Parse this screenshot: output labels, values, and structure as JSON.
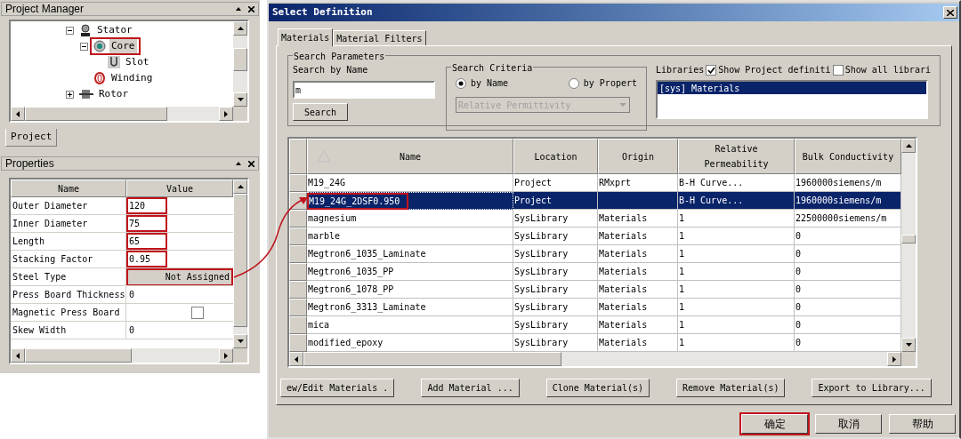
{
  "project_manager": {
    "title": "Project Manager",
    "tree": [
      {
        "label": "Stator",
        "kind": "stator",
        "expanded": true,
        "selected": false,
        "highlighted": false,
        "children": [
          {
            "label": "Core",
            "kind": "core",
            "expanded": true,
            "selected": true,
            "highlighted": true,
            "children": [
              {
                "label": "Slot",
                "kind": "slot",
                "selected": false,
                "highlighted": false
              }
            ]
          },
          {
            "label": "Winding",
            "kind": "winding",
            "selected": false,
            "highlighted": false
          }
        ]
      },
      {
        "label": "Rotor",
        "kind": "rotor",
        "expanded": false,
        "selected": false,
        "highlighted": false
      }
    ],
    "tab": "Project"
  },
  "properties": {
    "title": "Properties",
    "columns": [
      "Name",
      "Value"
    ],
    "rows": [
      {
        "name": "Outer Diameter",
        "value": "120",
        "kind": "text",
        "highlighted": true
      },
      {
        "name": "Inner Diameter",
        "value": "75",
        "kind": "text",
        "highlighted": true
      },
      {
        "name": "Length",
        "value": "65",
        "kind": "text",
        "highlighted": true
      },
      {
        "name": "Stacking Factor",
        "value": "0.95",
        "kind": "text",
        "highlighted": true
      },
      {
        "name": "Steel Type",
        "value": "Not Assigned",
        "kind": "button",
        "highlighted": true
      },
      {
        "name": "Press Board Thickness",
        "value": "0",
        "kind": "text",
        "highlighted": false
      },
      {
        "name": "Magnetic Press Board",
        "kind": "checkbox",
        "checked": false,
        "highlighted": false
      },
      {
        "name": "Skew Width",
        "value": "0",
        "kind": "text",
        "highlighted": false
      }
    ]
  },
  "dialog": {
    "title": "Select Definition",
    "tabs": [
      {
        "label": "Materials",
        "selected": true
      },
      {
        "label": "Material Filters",
        "selected": false
      }
    ],
    "search": {
      "group_title": "Search Parameters",
      "label": "Search by Name",
      "value": "m",
      "button": "Search"
    },
    "criteria": {
      "title": "Search Criteria",
      "options": [
        {
          "label": "by Name",
          "selected": true
        },
        {
          "label": "by Propert",
          "selected": false
        }
      ],
      "dropdown": {
        "value": "Relative Permittivity",
        "disabled": true
      }
    },
    "libraries": {
      "label": "Libraries",
      "checkboxes": [
        {
          "label": "Show Project definiti",
          "checked": true
        },
        {
          "label": "Show all librari",
          "checked": false
        }
      ],
      "items": [
        {
          "label": "[sys] Materials",
          "selected": true
        }
      ]
    },
    "table": {
      "columns": [
        "Name",
        "Location",
        "Origin",
        "Relative Permeability",
        "Bulk Conductivity"
      ],
      "rows": [
        {
          "cells": [
            "M19_24G",
            "Project",
            "RMxprt",
            "B-H Curve...",
            "1960000siemens/m"
          ],
          "selected": false,
          "highlighted": false
        },
        {
          "cells": [
            "M19_24G_2DSF0.950",
            "Project",
            "",
            "B-H Curve...",
            "1960000siemens/m"
          ],
          "selected": true,
          "highlighted": true
        },
        {
          "cells": [
            "magnesium",
            "SysLibrary",
            "Materials",
            "1",
            "22500000siemens/m"
          ],
          "selected": false,
          "highlighted": false
        },
        {
          "cells": [
            "marble",
            "SysLibrary",
            "Materials",
            "1",
            "0"
          ],
          "selected": false,
          "highlighted": false
        },
        {
          "cells": [
            "Megtron6_1035_Laminate",
            "SysLibrary",
            "Materials",
            "1",
            "0"
          ],
          "selected": false,
          "highlighted": false
        },
        {
          "cells": [
            "Megtron6_1035_PP",
            "SysLibrary",
            "Materials",
            "1",
            "0"
          ],
          "selected": false,
          "highlighted": false
        },
        {
          "cells": [
            "Megtron6_1078_PP",
            "SysLibrary",
            "Materials",
            "1",
            "0"
          ],
          "selected": false,
          "highlighted": false
        },
        {
          "cells": [
            "Megtron6_3313_Laminate",
            "SysLibrary",
            "Materials",
            "1",
            "0"
          ],
          "selected": false,
          "highlighted": false
        },
        {
          "cells": [
            "mica",
            "SysLibrary",
            "Materials",
            "1",
            "0"
          ],
          "selected": false,
          "highlighted": false
        },
        {
          "cells": [
            "modified_epoxy",
            "SysLibrary",
            "Materials",
            "1",
            "0"
          ],
          "selected": false,
          "highlighted": false
        }
      ]
    },
    "buttons": [
      "ew/Edit Materials .",
      "Add Material ...",
      "Clone Material(s)",
      "Remove Material(s)",
      "Export to Library..."
    ],
    "footer_buttons": [
      {
        "label": "确定",
        "highlighted": true
      },
      {
        "label": "取消",
        "highlighted": false
      },
      {
        "label": "帮助",
        "highlighted": false
      }
    ]
  }
}
